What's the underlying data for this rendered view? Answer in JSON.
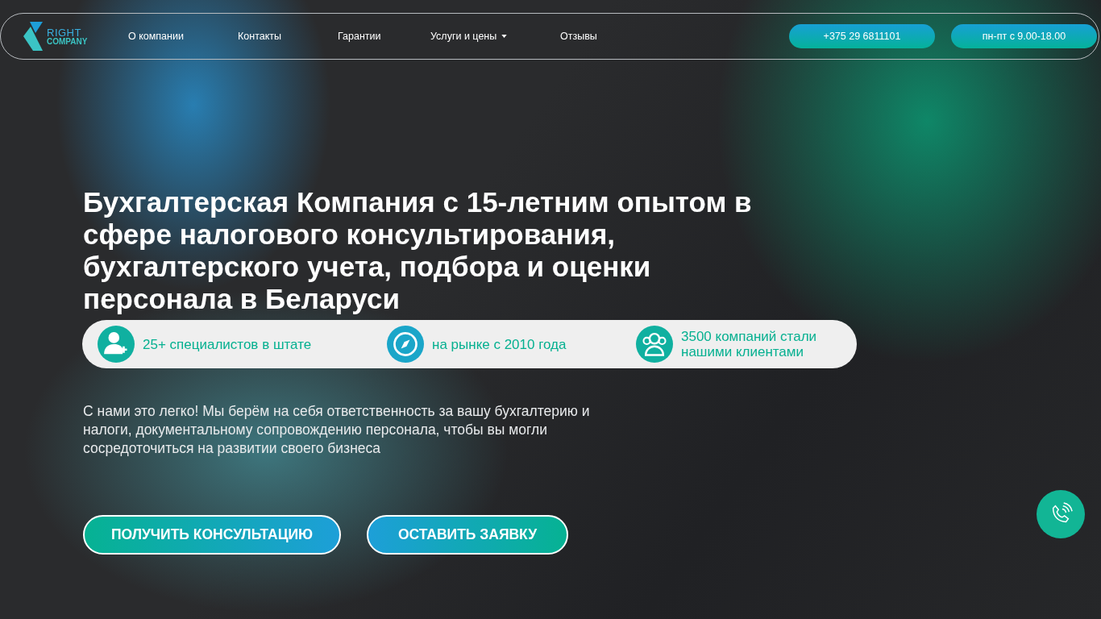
{
  "logo": {
    "line_1": "RIGHT",
    "line_2": "COMPANY"
  },
  "nav": [
    {
      "label": "О компании",
      "kind": "link"
    },
    {
      "label": "Контакты",
      "kind": "link"
    },
    {
      "label": "Гарантии",
      "kind": "link"
    },
    {
      "label": "Услуги и цены",
      "kind": "dropdown"
    },
    {
      "label": "Отзывы",
      "kind": "link"
    }
  ],
  "header_buttons": [
    "+375 29 6811101",
    "пн-пт с 9.00-18.00"
  ],
  "hero": {
    "title": "Бухгалтерская Компания с 15-летним опытом в сфере налогового консультирования, бухгалтерского учета, подбора и оценки персонала в Беларуси",
    "stats": [
      {
        "kind": "person",
        "text": "25+ специалистов в штате"
      },
      {
        "kind": "compass",
        "text": "на рынке с 2010 года"
      },
      {
        "kind": "group",
        "text": "3500 компаний стали нашими клиентами"
      }
    ],
    "description": "С нами это легко! Мы берём на себя ответственность за вашу бухгалтерию и налоги, документальному сопровождению персонала, чтобы вы могли сосредоточиться на развитии своего бизнеса",
    "buttons": [
      {
        "label": "ПОЛУЧИТЬ КОНСУЛЬТАЦИЮ",
        "kind": "green"
      },
      {
        "label": "ОСТАВИТЬ ЗАЯВКУ",
        "kind": "blue"
      }
    ]
  }
}
